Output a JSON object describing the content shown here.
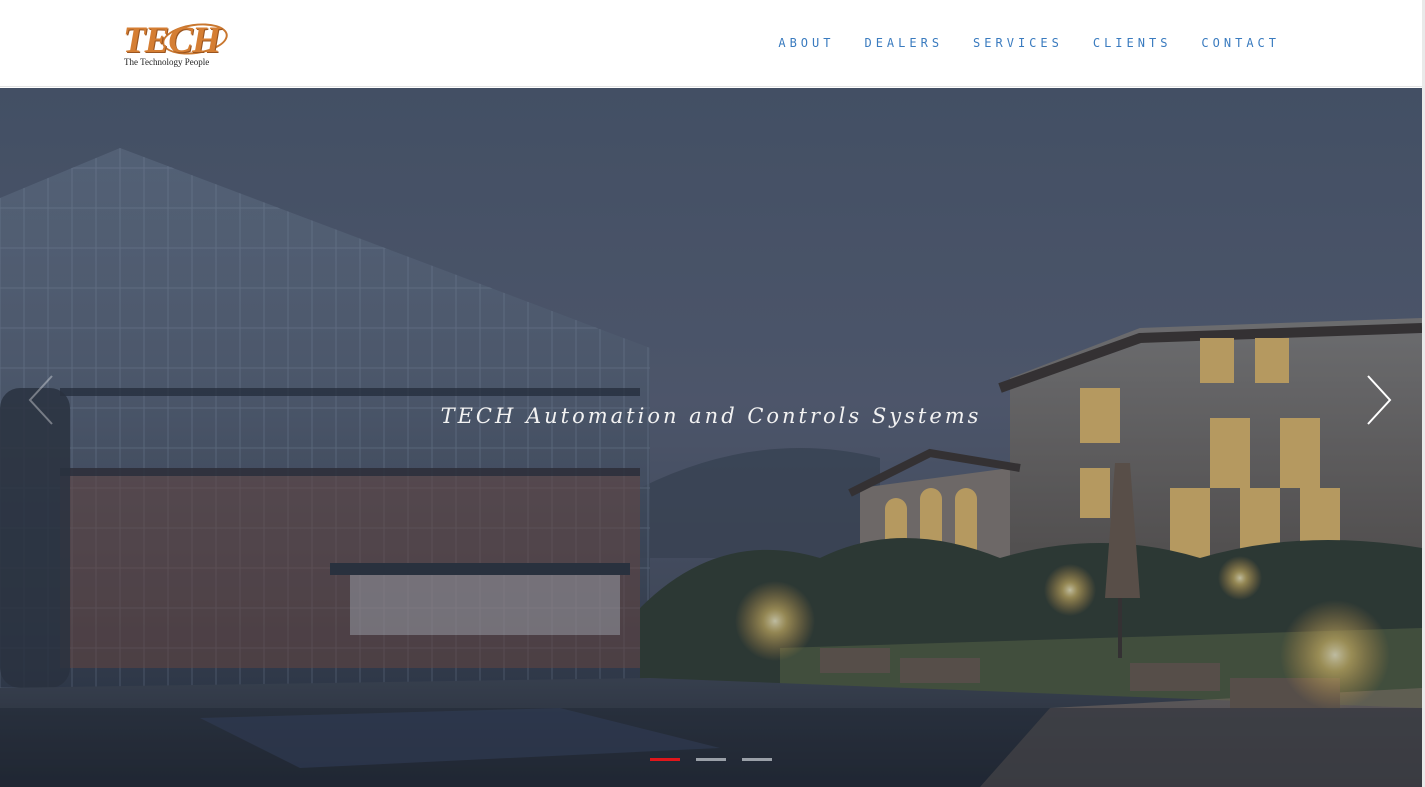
{
  "logo": {
    "word": "TECH",
    "tagline": "The Technology People",
    "icon": "tech-logo"
  },
  "nav": {
    "items": [
      {
        "label": "ABOUT"
      },
      {
        "label": "DEALERS"
      },
      {
        "label": "SERVICES"
      },
      {
        "label": "CLIENTS"
      },
      {
        "label": "CONTACT"
      }
    ]
  },
  "hero": {
    "caption": "TECH Automation and Controls Systems",
    "prev_icon": "chevron-left-icon",
    "next_icon": "chevron-right-icon",
    "slides_total": 3,
    "active_slide": 1
  },
  "colors": {
    "nav_text": "#3a7bbf",
    "logo_orange": "#d57e33",
    "dot_active": "#e0161b",
    "dot_inactive": "#9aa0a8"
  }
}
